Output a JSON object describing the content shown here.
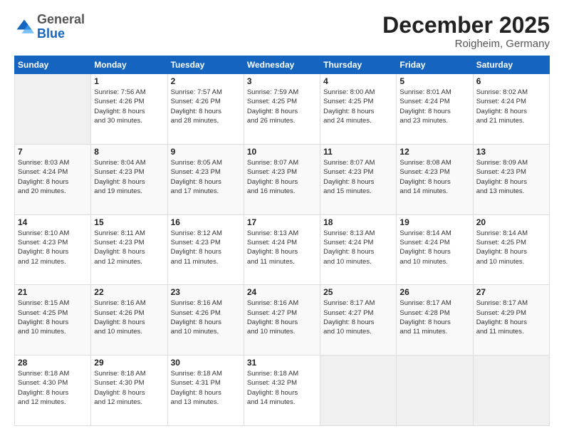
{
  "header": {
    "logo_general": "General",
    "logo_blue": "Blue",
    "month_year": "December 2025",
    "location": "Roigheim, Germany"
  },
  "days_of_week": [
    "Sunday",
    "Monday",
    "Tuesday",
    "Wednesday",
    "Thursday",
    "Friday",
    "Saturday"
  ],
  "weeks": [
    [
      {
        "day": "",
        "info": ""
      },
      {
        "day": "1",
        "info": "Sunrise: 7:56 AM\nSunset: 4:26 PM\nDaylight: 8 hours\nand 30 minutes."
      },
      {
        "day": "2",
        "info": "Sunrise: 7:57 AM\nSunset: 4:26 PM\nDaylight: 8 hours\nand 28 minutes."
      },
      {
        "day": "3",
        "info": "Sunrise: 7:59 AM\nSunset: 4:25 PM\nDaylight: 8 hours\nand 26 minutes."
      },
      {
        "day": "4",
        "info": "Sunrise: 8:00 AM\nSunset: 4:25 PM\nDaylight: 8 hours\nand 24 minutes."
      },
      {
        "day": "5",
        "info": "Sunrise: 8:01 AM\nSunset: 4:24 PM\nDaylight: 8 hours\nand 23 minutes."
      },
      {
        "day": "6",
        "info": "Sunrise: 8:02 AM\nSunset: 4:24 PM\nDaylight: 8 hours\nand 21 minutes."
      }
    ],
    [
      {
        "day": "7",
        "info": "Sunrise: 8:03 AM\nSunset: 4:24 PM\nDaylight: 8 hours\nand 20 minutes."
      },
      {
        "day": "8",
        "info": "Sunrise: 8:04 AM\nSunset: 4:23 PM\nDaylight: 8 hours\nand 19 minutes."
      },
      {
        "day": "9",
        "info": "Sunrise: 8:05 AM\nSunset: 4:23 PM\nDaylight: 8 hours\nand 17 minutes."
      },
      {
        "day": "10",
        "info": "Sunrise: 8:07 AM\nSunset: 4:23 PM\nDaylight: 8 hours\nand 16 minutes."
      },
      {
        "day": "11",
        "info": "Sunrise: 8:07 AM\nSunset: 4:23 PM\nDaylight: 8 hours\nand 15 minutes."
      },
      {
        "day": "12",
        "info": "Sunrise: 8:08 AM\nSunset: 4:23 PM\nDaylight: 8 hours\nand 14 minutes."
      },
      {
        "day": "13",
        "info": "Sunrise: 8:09 AM\nSunset: 4:23 PM\nDaylight: 8 hours\nand 13 minutes."
      }
    ],
    [
      {
        "day": "14",
        "info": "Sunrise: 8:10 AM\nSunset: 4:23 PM\nDaylight: 8 hours\nand 12 minutes."
      },
      {
        "day": "15",
        "info": "Sunrise: 8:11 AM\nSunset: 4:23 PM\nDaylight: 8 hours\nand 12 minutes."
      },
      {
        "day": "16",
        "info": "Sunrise: 8:12 AM\nSunset: 4:23 PM\nDaylight: 8 hours\nand 11 minutes."
      },
      {
        "day": "17",
        "info": "Sunrise: 8:13 AM\nSunset: 4:24 PM\nDaylight: 8 hours\nand 11 minutes."
      },
      {
        "day": "18",
        "info": "Sunrise: 8:13 AM\nSunset: 4:24 PM\nDaylight: 8 hours\nand 10 minutes."
      },
      {
        "day": "19",
        "info": "Sunrise: 8:14 AM\nSunset: 4:24 PM\nDaylight: 8 hours\nand 10 minutes."
      },
      {
        "day": "20",
        "info": "Sunrise: 8:14 AM\nSunset: 4:25 PM\nDaylight: 8 hours\nand 10 minutes."
      }
    ],
    [
      {
        "day": "21",
        "info": "Sunrise: 8:15 AM\nSunset: 4:25 PM\nDaylight: 8 hours\nand 10 minutes."
      },
      {
        "day": "22",
        "info": "Sunrise: 8:16 AM\nSunset: 4:26 PM\nDaylight: 8 hours\nand 10 minutes."
      },
      {
        "day": "23",
        "info": "Sunrise: 8:16 AM\nSunset: 4:26 PM\nDaylight: 8 hours\nand 10 minutes."
      },
      {
        "day": "24",
        "info": "Sunrise: 8:16 AM\nSunset: 4:27 PM\nDaylight: 8 hours\nand 10 minutes."
      },
      {
        "day": "25",
        "info": "Sunrise: 8:17 AM\nSunset: 4:27 PM\nDaylight: 8 hours\nand 10 minutes."
      },
      {
        "day": "26",
        "info": "Sunrise: 8:17 AM\nSunset: 4:28 PM\nDaylight: 8 hours\nand 11 minutes."
      },
      {
        "day": "27",
        "info": "Sunrise: 8:17 AM\nSunset: 4:29 PM\nDaylight: 8 hours\nand 11 minutes."
      }
    ],
    [
      {
        "day": "28",
        "info": "Sunrise: 8:18 AM\nSunset: 4:30 PM\nDaylight: 8 hours\nand 12 minutes."
      },
      {
        "day": "29",
        "info": "Sunrise: 8:18 AM\nSunset: 4:30 PM\nDaylight: 8 hours\nand 12 minutes."
      },
      {
        "day": "30",
        "info": "Sunrise: 8:18 AM\nSunset: 4:31 PM\nDaylight: 8 hours\nand 13 minutes."
      },
      {
        "day": "31",
        "info": "Sunrise: 8:18 AM\nSunset: 4:32 PM\nDaylight: 8 hours\nand 14 minutes."
      },
      {
        "day": "",
        "info": ""
      },
      {
        "day": "",
        "info": ""
      },
      {
        "day": "",
        "info": ""
      }
    ]
  ]
}
